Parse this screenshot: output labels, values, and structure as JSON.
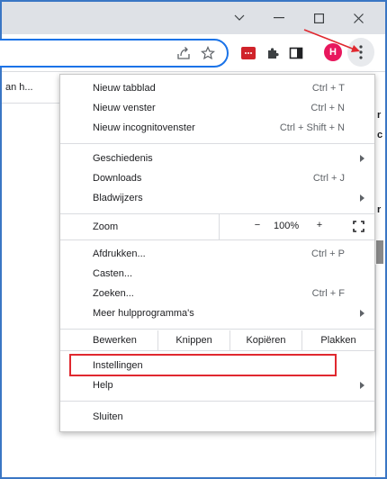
{
  "window": {
    "controls": [
      "chevron-down",
      "minimize",
      "maximize",
      "close"
    ]
  },
  "toolbar": {
    "avatar_letter": "H",
    "icons": [
      "share-icon",
      "star-icon",
      "extension-icon",
      "puzzle-icon",
      "sidepanel-icon",
      "kebab-menu-icon"
    ]
  },
  "page": {
    "tab_text": "an h...",
    "right_glyphs": [
      "r",
      "c",
      "r"
    ]
  },
  "menu": {
    "new_tab": {
      "label": "Nieuw tabblad",
      "shortcut": "Ctrl + T"
    },
    "new_window": {
      "label": "Nieuw venster",
      "shortcut": "Ctrl + N"
    },
    "new_incognito": {
      "label": "Nieuw incognitovenster",
      "shortcut": "Ctrl + Shift + N"
    },
    "history": {
      "label": "Geschiedenis"
    },
    "downloads": {
      "label": "Downloads",
      "shortcut": "Ctrl + J"
    },
    "bookmarks": {
      "label": "Bladwijzers"
    },
    "zoom": {
      "label": "Zoom",
      "minus": "−",
      "value": "100%",
      "plus": "+"
    },
    "print": {
      "label": "Afdrukken...",
      "shortcut": "Ctrl + P"
    },
    "cast": {
      "label": "Casten..."
    },
    "find": {
      "label": "Zoeken...",
      "shortcut": "Ctrl + F"
    },
    "more_tools": {
      "label": "Meer hulpprogramma's"
    },
    "edit": {
      "label": "Bewerken",
      "cut": "Knippen",
      "copy": "Kopiëren",
      "paste": "Plakken"
    },
    "settings": {
      "label": "Instellingen"
    },
    "help": {
      "label": "Help"
    },
    "exit": {
      "label": "Sluiten"
    }
  },
  "colors": {
    "highlight": "#e0282f",
    "accent": "#1a73e8",
    "avatar": "#e8175d",
    "frame": "#3a76c4"
  }
}
